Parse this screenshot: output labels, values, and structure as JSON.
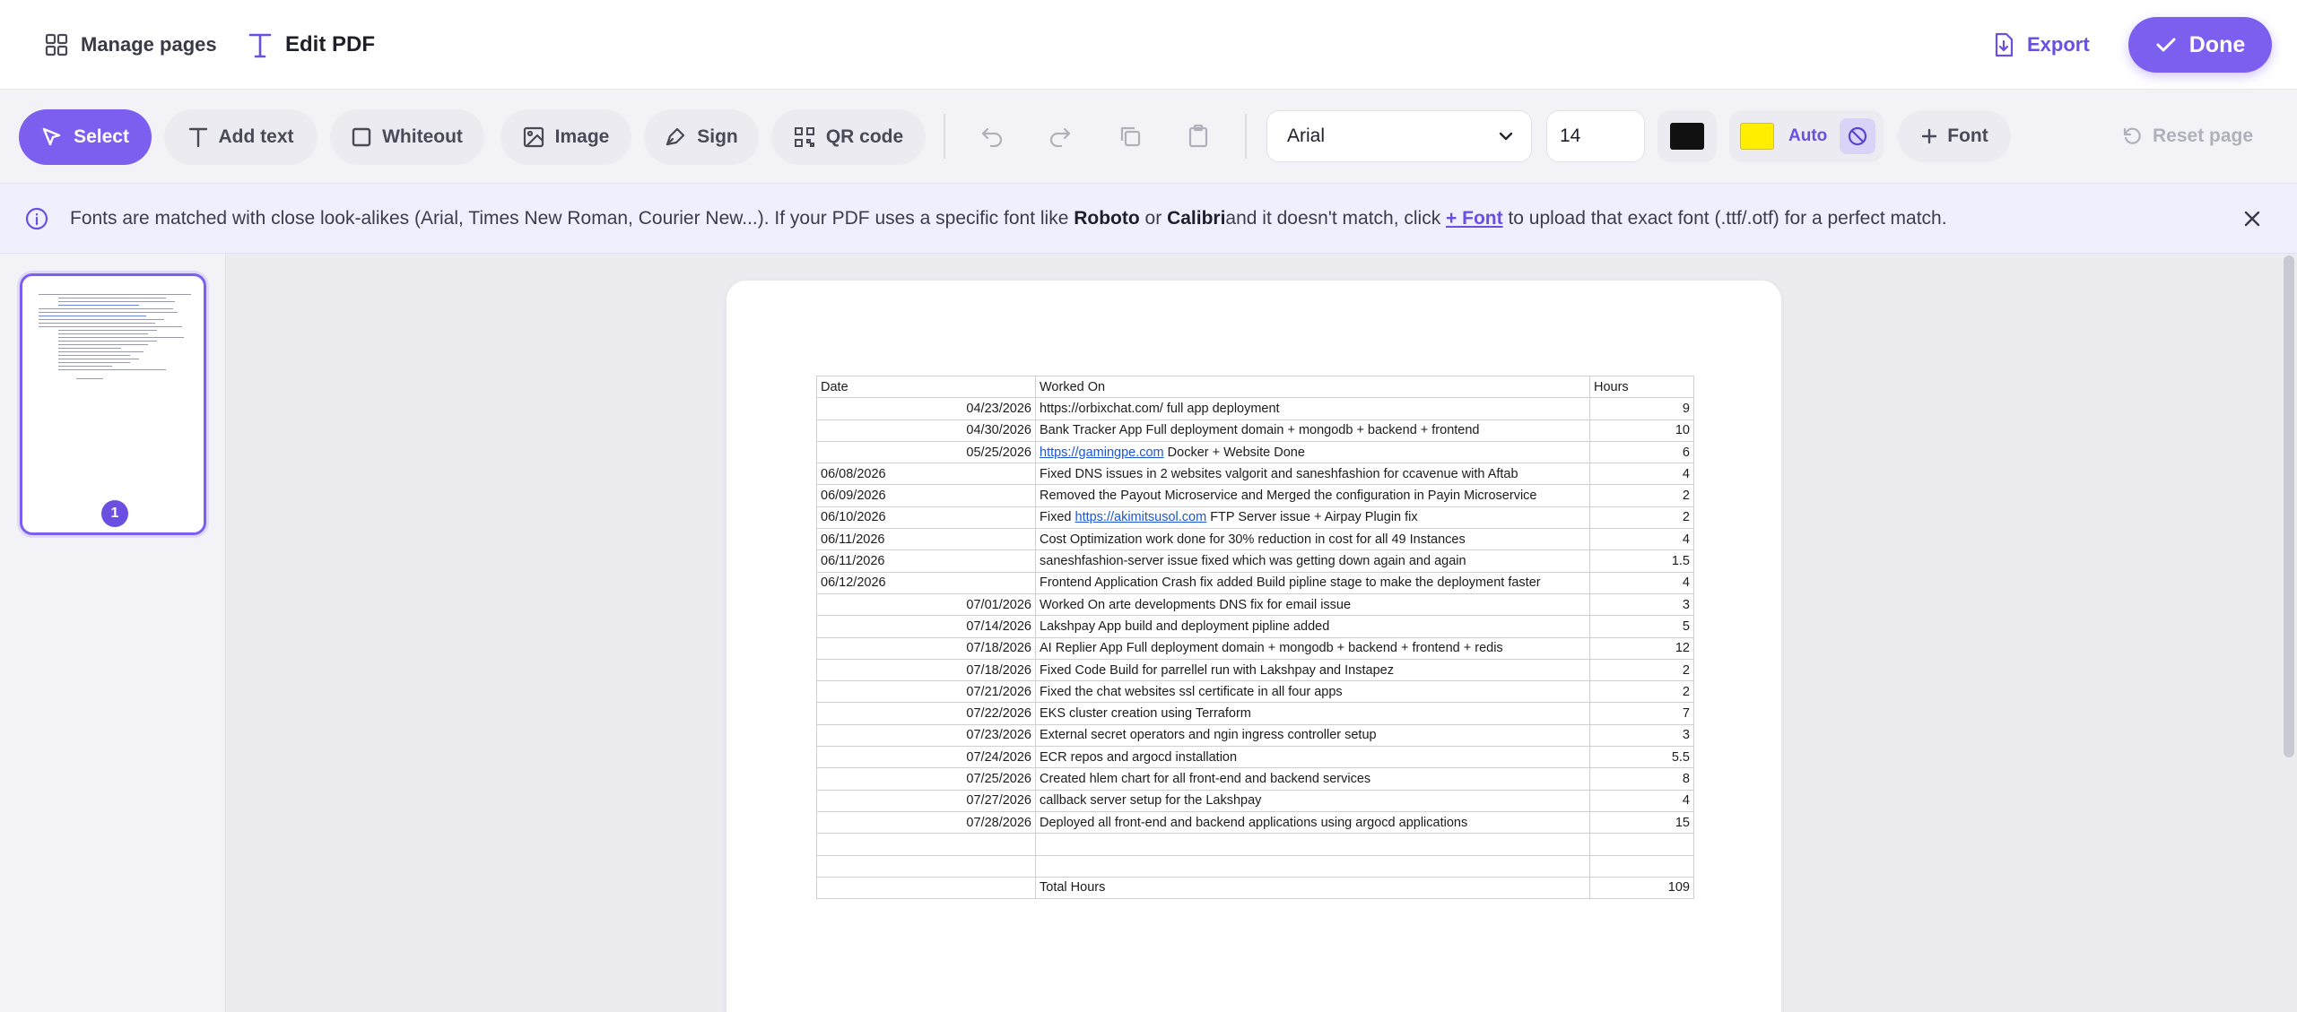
{
  "header": {
    "manage_pages": "Manage pages",
    "edit_pdf": "Edit PDF",
    "export": "Export",
    "done": "Done"
  },
  "toolbar": {
    "select": "Select",
    "add_text": "Add text",
    "whiteout": "Whiteout",
    "image": "Image",
    "sign": "Sign",
    "qr_code": "QR code",
    "font_family": "Arial",
    "font_size": "14",
    "text_color": "#111111",
    "highlight_color": "#ffee00",
    "auto": "Auto",
    "font": "Font",
    "reset_page": "Reset page"
  },
  "banner": {
    "text_1": "Fonts are matched with close look-alikes (Arial, Times New Roman, Courier New...). If your PDF uses a specific font like ",
    "font_a": "Roboto",
    "text_2": " or ",
    "font_b": "Calibri",
    "text_3": "and it doesn't match, click ",
    "link": "+ Font",
    "text_4": " to upload that exact font (.ttf/.otf) for a perfect match."
  },
  "thumbnail": {
    "page_number": "1"
  },
  "table": {
    "headers": {
      "date": "Date",
      "worked_on": "Worked On",
      "hours": "Hours"
    },
    "rows": [
      {
        "date": "04/23/2026",
        "align": "right",
        "pre": "https://orbixchat.com/ full app deployment",
        "link": "",
        "post": "",
        "hours": "9"
      },
      {
        "date": "04/30/2026",
        "align": "right",
        "pre": "Bank Tracker App Full deployment domain + mongodb + backend + frontend",
        "link": "",
        "post": "",
        "hours": "10"
      },
      {
        "date": "05/25/2026",
        "align": "right",
        "pre": "",
        "link": "https://gamingpe.com",
        "post": " Docker + Website Done",
        "hours": "6"
      },
      {
        "date": "06/08/2026",
        "align": "left",
        "pre": "Fixed DNS issues in 2 websites valgorit and saneshfashion for ccavenue with Aftab",
        "link": "",
        "post": "",
        "hours": "4"
      },
      {
        "date": "06/09/2026",
        "align": "left",
        "pre": "Removed the Payout Microservice and Merged the configuration in Payin Microservice",
        "link": "",
        "post": "",
        "hours": "2"
      },
      {
        "date": "06/10/2026",
        "align": "left",
        "pre": "Fixed ",
        "link": "https://akimitsusol.com",
        "post": " FTP Server issue + Airpay Plugin fix",
        "hours": "2"
      },
      {
        "date": "06/11/2026",
        "align": "left",
        "pre": "Cost Optimization work done for 30% reduction in cost for all 49 Instances",
        "link": "",
        "post": "",
        "hours": "4"
      },
      {
        "date": "06/11/2026",
        "align": "left",
        "pre": "saneshfashion-server issue fixed which was getting down again and again",
        "link": "",
        "post": "",
        "hours": "1.5"
      },
      {
        "date": "06/12/2026",
        "align": "left",
        "pre": "Frontend Application Crash fix added Build pipline stage to make the deployment faster",
        "link": "",
        "post": "",
        "hours": "4"
      },
      {
        "date": "07/01/2026",
        "align": "right",
        "pre": "Worked On arte developments DNS fix for email issue",
        "link": "",
        "post": "",
        "hours": "3"
      },
      {
        "date": "07/14/2026",
        "align": "right",
        "pre": "Lakshpay App build and deployment pipline added",
        "link": "",
        "post": "",
        "hours": "5"
      },
      {
        "date": "07/18/2026",
        "align": "right",
        "pre": "AI Replier App Full deployment domain + mongodb + backend + frontend + redis",
        "link": "",
        "post": "",
        "hours": "12"
      },
      {
        "date": "07/18/2026",
        "align": "right",
        "pre": "Fixed Code Build for parrellel run with Lakshpay and Instapez",
        "link": "",
        "post": "",
        "hours": "2"
      },
      {
        "date": "07/21/2026",
        "align": "right",
        "pre": "Fixed the chat websites ssl certificate in all four apps",
        "link": "",
        "post": "",
        "hours": "2"
      },
      {
        "date": "07/22/2026",
        "align": "right",
        "pre": "EKS cluster creation using Terraform",
        "link": "",
        "post": "",
        "hours": "7"
      },
      {
        "date": "07/23/2026",
        "align": "right",
        "pre": "External secret operators and ngin ingress controller setup",
        "link": "",
        "post": "",
        "hours": "3"
      },
      {
        "date": "07/24/2026",
        "align": "right",
        "pre": "ECR repos and argocd installation",
        "link": "",
        "post": "",
        "hours": "5.5"
      },
      {
        "date": "07/25/2026",
        "align": "right",
        "pre": "Created hlem chart for all front-end and backend services",
        "link": "",
        "post": "",
        "hours": "8"
      },
      {
        "date": "07/27/2026",
        "align": "right",
        "pre": "callback server setup for the Lakshpay",
        "link": "",
        "post": "",
        "hours": "4"
      },
      {
        "date": "07/28/2026",
        "align": "right",
        "pre": "Deployed all front-end and backend applications using argocd applications",
        "link": "",
        "post": "",
        "hours": "15"
      },
      {
        "date": "",
        "align": "left",
        "pre": "",
        "link": "",
        "post": "",
        "hours": ""
      },
      {
        "date": "",
        "align": "left",
        "pre": "",
        "link": "",
        "post": "",
        "hours": ""
      }
    ],
    "total_label": "Total Hours",
    "total_value": "109"
  }
}
